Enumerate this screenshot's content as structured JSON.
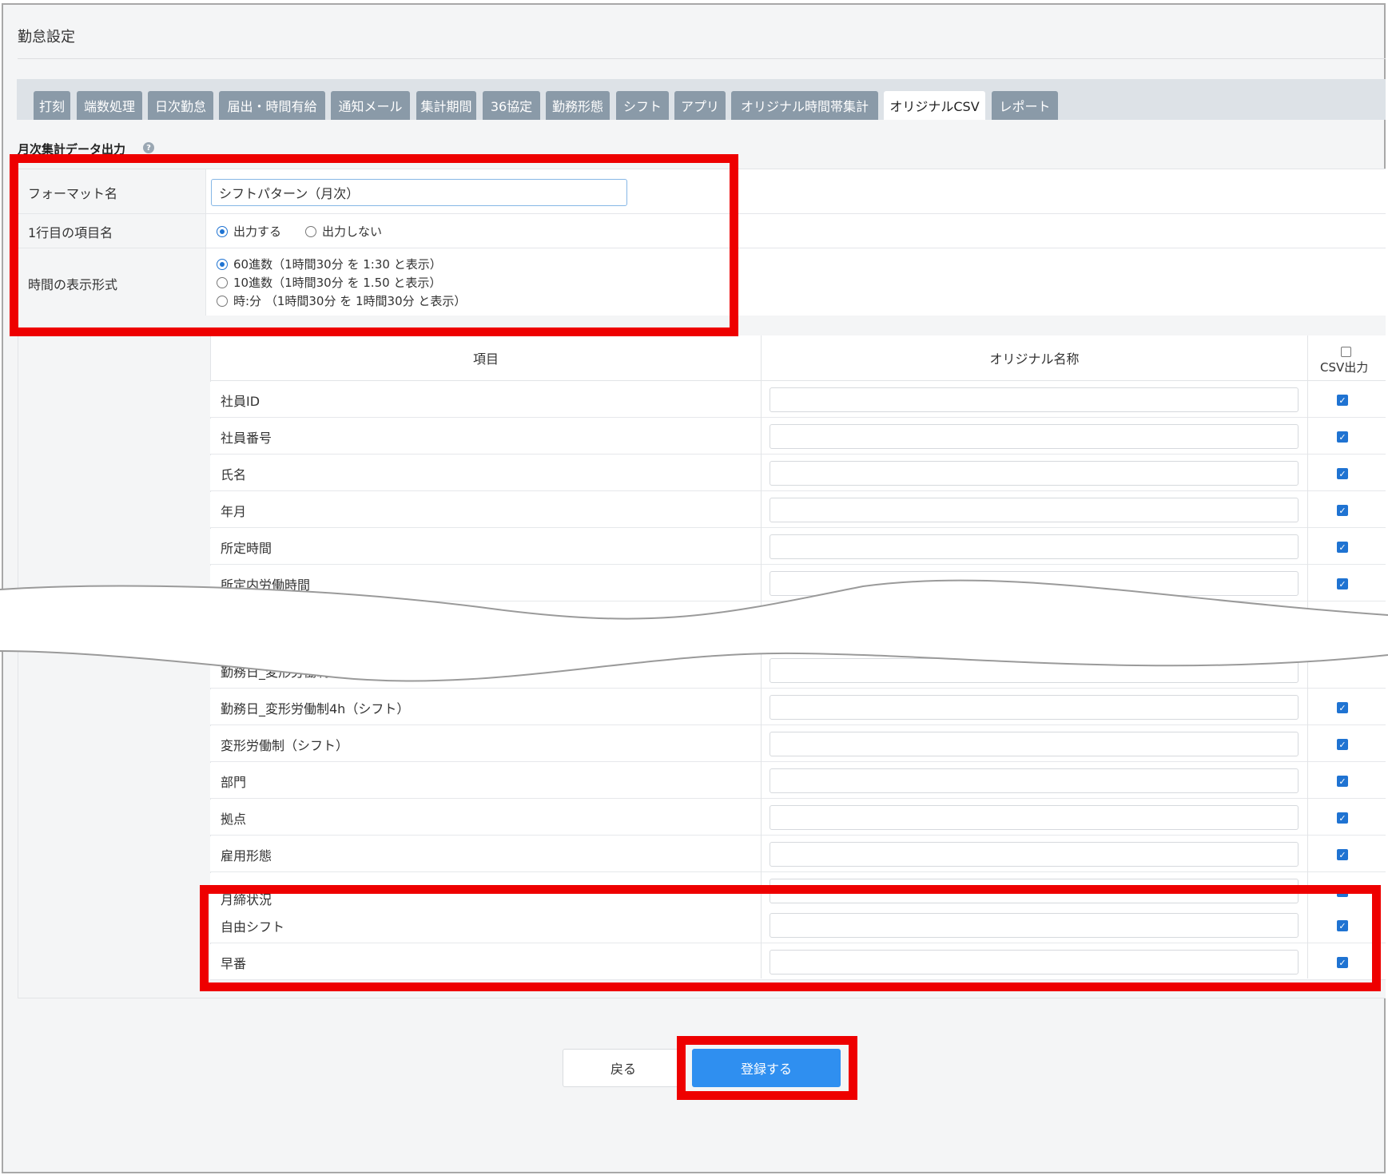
{
  "page_title": "勤怠設定",
  "tabs": [
    {
      "label": "打刻",
      "active": false
    },
    {
      "label": "端数処理",
      "active": false
    },
    {
      "label": "日次勤怠",
      "active": false
    },
    {
      "label": "届出・時間有給",
      "active": false
    },
    {
      "label": "通知メール",
      "active": false
    },
    {
      "label": "集計期間",
      "active": false
    },
    {
      "label": "36協定",
      "active": false
    },
    {
      "label": "勤務形態",
      "active": false
    },
    {
      "label": "シフト",
      "active": false
    },
    {
      "label": "アプリ",
      "active": false
    },
    {
      "label": "オリジナル時間帯集計",
      "active": false
    },
    {
      "label": "オリジナルCSV",
      "active": true
    },
    {
      "label": "レポート",
      "active": false
    }
  ],
  "section_title": "月次集計データ出力",
  "help_icon": "question-circle-icon",
  "format": {
    "label": "フォーマット名",
    "value": "シフトパターン（月次）"
  },
  "first_row": {
    "label": "1行目の項目名",
    "options": [
      {
        "label": "出力する",
        "selected": true
      },
      {
        "label": "出力しない",
        "selected": false
      }
    ]
  },
  "time_format": {
    "label": "時間の表示形式",
    "options": [
      {
        "label": "60進数（1時間30分 を 1:30 と表示）",
        "selected": true
      },
      {
        "label": "10進数（1時間30分 を 1.50 と表示）",
        "selected": false
      },
      {
        "label": "時:分 （1時間30分 を 1時間30分 と表示）",
        "selected": false
      }
    ]
  },
  "table": {
    "headers": {
      "item": "項目",
      "original_name": "オリジナル名称",
      "csv_output": "CSV出力"
    },
    "header_checkbox_checked": false,
    "rows_top": [
      {
        "label": "社員ID",
        "checked": true
      },
      {
        "label": "社員番号",
        "checked": true
      },
      {
        "label": "氏名",
        "checked": true
      },
      {
        "label": "年月",
        "checked": true
      },
      {
        "label": "所定時間",
        "checked": true
      },
      {
        "label": "所定内労働時間",
        "checked": true
      }
    ],
    "rows_bottom_partial": "勤務日_変形労働制",
    "rows_bottom": [
      {
        "label": "勤務日_変形労働制4h（シフト）",
        "checked": true
      },
      {
        "label": "変形労働制（シフト）",
        "checked": true
      },
      {
        "label": "部門",
        "checked": true
      },
      {
        "label": "拠点",
        "checked": true
      },
      {
        "label": "雇用形態",
        "checked": true
      }
    ],
    "row_partial_hidden": "月締状況",
    "rows_highlighted": [
      {
        "label": "自由シフト",
        "checked": true
      },
      {
        "label": "早番",
        "checked": true
      }
    ]
  },
  "buttons": {
    "back": "戻る",
    "save": "登録する"
  },
  "colors": {
    "highlight": "#ee0000",
    "primary": "#2f8ff0",
    "tab": "#8a9aa8",
    "checkbox": "#1f73d2"
  }
}
